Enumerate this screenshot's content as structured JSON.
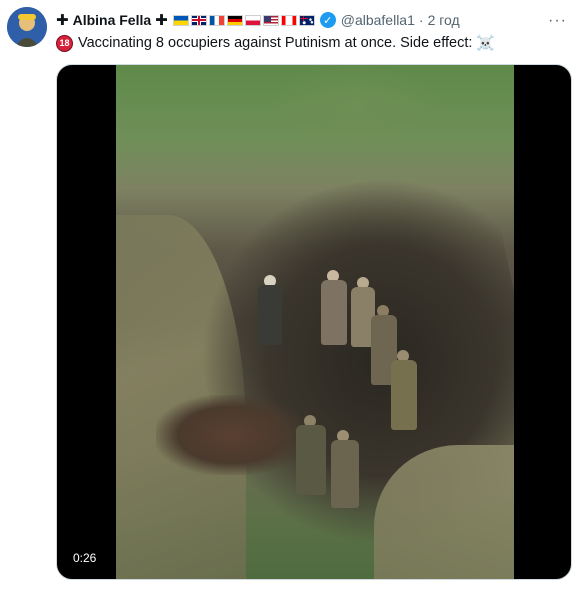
{
  "tweet": {
    "author_name": "Albina Fella",
    "name_prefix": "✚",
    "name_suffix": "✚",
    "flags": [
      {
        "country": "ukraine",
        "colors": [
          "#0057b7",
          "#ffd700"
        ]
      },
      {
        "country": "united-kingdom",
        "colors": [
          "#012169",
          "#c8102e",
          "#ffffff"
        ]
      },
      {
        "country": "france",
        "colors": [
          "#0055a4",
          "#ffffff",
          "#ef4135"
        ]
      },
      {
        "country": "germany",
        "colors": [
          "#000000",
          "#dd0000",
          "#ffce00"
        ]
      },
      {
        "country": "poland",
        "colors": [
          "#ffffff",
          "#dc143c"
        ]
      },
      {
        "country": "united-states",
        "colors": [
          "#b22234",
          "#ffffff",
          "#3c3b6e"
        ]
      },
      {
        "country": "canada",
        "colors": [
          "#ff0000",
          "#ffffff"
        ]
      },
      {
        "country": "australia",
        "colors": [
          "#012169",
          "#ffffff"
        ]
      }
    ],
    "verified_icon": "verified-badge-icon",
    "handle": "@albafella1",
    "separator": "·",
    "time": "2 год",
    "more_label": "···",
    "age_badge": "18",
    "text": "Vaccinating 8 occupiers against Putinism at once. Side effect:",
    "skull_emoji": "☠️"
  },
  "video": {
    "duration": "0:26"
  },
  "colors": {
    "verified": "#1d9bf0",
    "secondary_text": "#536471",
    "age_badge": "#d6213a"
  }
}
